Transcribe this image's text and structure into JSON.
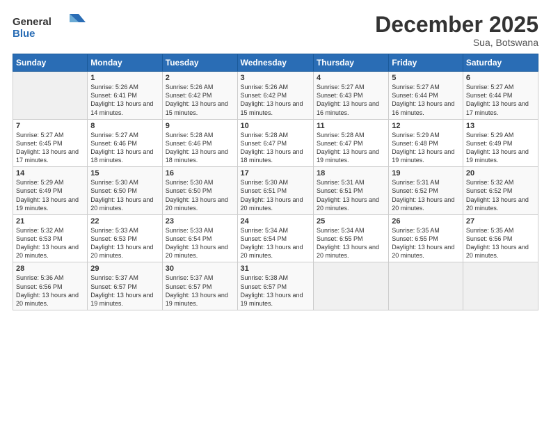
{
  "logo": {
    "general": "General",
    "blue": "Blue"
  },
  "title": "December 2025",
  "location": "Sua, Botswana",
  "headers": [
    "Sunday",
    "Monday",
    "Tuesday",
    "Wednesday",
    "Thursday",
    "Friday",
    "Saturday"
  ],
  "weeks": [
    [
      {
        "day": "",
        "sunrise": "",
        "sunset": "",
        "daylight": ""
      },
      {
        "day": "1",
        "sunrise": "Sunrise: 5:26 AM",
        "sunset": "Sunset: 6:41 PM",
        "daylight": "Daylight: 13 hours and 14 minutes."
      },
      {
        "day": "2",
        "sunrise": "Sunrise: 5:26 AM",
        "sunset": "Sunset: 6:42 PM",
        "daylight": "Daylight: 13 hours and 15 minutes."
      },
      {
        "day": "3",
        "sunrise": "Sunrise: 5:26 AM",
        "sunset": "Sunset: 6:42 PM",
        "daylight": "Daylight: 13 hours and 15 minutes."
      },
      {
        "day": "4",
        "sunrise": "Sunrise: 5:27 AM",
        "sunset": "Sunset: 6:43 PM",
        "daylight": "Daylight: 13 hours and 16 minutes."
      },
      {
        "day": "5",
        "sunrise": "Sunrise: 5:27 AM",
        "sunset": "Sunset: 6:44 PM",
        "daylight": "Daylight: 13 hours and 16 minutes."
      },
      {
        "day": "6",
        "sunrise": "Sunrise: 5:27 AM",
        "sunset": "Sunset: 6:44 PM",
        "daylight": "Daylight: 13 hours and 17 minutes."
      }
    ],
    [
      {
        "day": "7",
        "sunrise": "Sunrise: 5:27 AM",
        "sunset": "Sunset: 6:45 PM",
        "daylight": "Daylight: 13 hours and 17 minutes."
      },
      {
        "day": "8",
        "sunrise": "Sunrise: 5:27 AM",
        "sunset": "Sunset: 6:46 PM",
        "daylight": "Daylight: 13 hours and 18 minutes."
      },
      {
        "day": "9",
        "sunrise": "Sunrise: 5:28 AM",
        "sunset": "Sunset: 6:46 PM",
        "daylight": "Daylight: 13 hours and 18 minutes."
      },
      {
        "day": "10",
        "sunrise": "Sunrise: 5:28 AM",
        "sunset": "Sunset: 6:47 PM",
        "daylight": "Daylight: 13 hours and 18 minutes."
      },
      {
        "day": "11",
        "sunrise": "Sunrise: 5:28 AM",
        "sunset": "Sunset: 6:47 PM",
        "daylight": "Daylight: 13 hours and 19 minutes."
      },
      {
        "day": "12",
        "sunrise": "Sunrise: 5:29 AM",
        "sunset": "Sunset: 6:48 PM",
        "daylight": "Daylight: 13 hours and 19 minutes."
      },
      {
        "day": "13",
        "sunrise": "Sunrise: 5:29 AM",
        "sunset": "Sunset: 6:49 PM",
        "daylight": "Daylight: 13 hours and 19 minutes."
      }
    ],
    [
      {
        "day": "14",
        "sunrise": "Sunrise: 5:29 AM",
        "sunset": "Sunset: 6:49 PM",
        "daylight": "Daylight: 13 hours and 19 minutes."
      },
      {
        "day": "15",
        "sunrise": "Sunrise: 5:30 AM",
        "sunset": "Sunset: 6:50 PM",
        "daylight": "Daylight: 13 hours and 20 minutes."
      },
      {
        "day": "16",
        "sunrise": "Sunrise: 5:30 AM",
        "sunset": "Sunset: 6:50 PM",
        "daylight": "Daylight: 13 hours and 20 minutes."
      },
      {
        "day": "17",
        "sunrise": "Sunrise: 5:30 AM",
        "sunset": "Sunset: 6:51 PM",
        "daylight": "Daylight: 13 hours and 20 minutes."
      },
      {
        "day": "18",
        "sunrise": "Sunrise: 5:31 AM",
        "sunset": "Sunset: 6:51 PM",
        "daylight": "Daylight: 13 hours and 20 minutes."
      },
      {
        "day": "19",
        "sunrise": "Sunrise: 5:31 AM",
        "sunset": "Sunset: 6:52 PM",
        "daylight": "Daylight: 13 hours and 20 minutes."
      },
      {
        "day": "20",
        "sunrise": "Sunrise: 5:32 AM",
        "sunset": "Sunset: 6:52 PM",
        "daylight": "Daylight: 13 hours and 20 minutes."
      }
    ],
    [
      {
        "day": "21",
        "sunrise": "Sunrise: 5:32 AM",
        "sunset": "Sunset: 6:53 PM",
        "daylight": "Daylight: 13 hours and 20 minutes."
      },
      {
        "day": "22",
        "sunrise": "Sunrise: 5:33 AM",
        "sunset": "Sunset: 6:53 PM",
        "daylight": "Daylight: 13 hours and 20 minutes."
      },
      {
        "day": "23",
        "sunrise": "Sunrise: 5:33 AM",
        "sunset": "Sunset: 6:54 PM",
        "daylight": "Daylight: 13 hours and 20 minutes."
      },
      {
        "day": "24",
        "sunrise": "Sunrise: 5:34 AM",
        "sunset": "Sunset: 6:54 PM",
        "daylight": "Daylight: 13 hours and 20 minutes."
      },
      {
        "day": "25",
        "sunrise": "Sunrise: 5:34 AM",
        "sunset": "Sunset: 6:55 PM",
        "daylight": "Daylight: 13 hours and 20 minutes."
      },
      {
        "day": "26",
        "sunrise": "Sunrise: 5:35 AM",
        "sunset": "Sunset: 6:55 PM",
        "daylight": "Daylight: 13 hours and 20 minutes."
      },
      {
        "day": "27",
        "sunrise": "Sunrise: 5:35 AM",
        "sunset": "Sunset: 6:56 PM",
        "daylight": "Daylight: 13 hours and 20 minutes."
      }
    ],
    [
      {
        "day": "28",
        "sunrise": "Sunrise: 5:36 AM",
        "sunset": "Sunset: 6:56 PM",
        "daylight": "Daylight: 13 hours and 20 minutes."
      },
      {
        "day": "29",
        "sunrise": "Sunrise: 5:37 AM",
        "sunset": "Sunset: 6:57 PM",
        "daylight": "Daylight: 13 hours and 19 minutes."
      },
      {
        "day": "30",
        "sunrise": "Sunrise: 5:37 AM",
        "sunset": "Sunset: 6:57 PM",
        "daylight": "Daylight: 13 hours and 19 minutes."
      },
      {
        "day": "31",
        "sunrise": "Sunrise: 5:38 AM",
        "sunset": "Sunset: 6:57 PM",
        "daylight": "Daylight: 13 hours and 19 minutes."
      },
      {
        "day": "",
        "sunrise": "",
        "sunset": "",
        "daylight": ""
      },
      {
        "day": "",
        "sunrise": "",
        "sunset": "",
        "daylight": ""
      },
      {
        "day": "",
        "sunrise": "",
        "sunset": "",
        "daylight": ""
      }
    ]
  ]
}
